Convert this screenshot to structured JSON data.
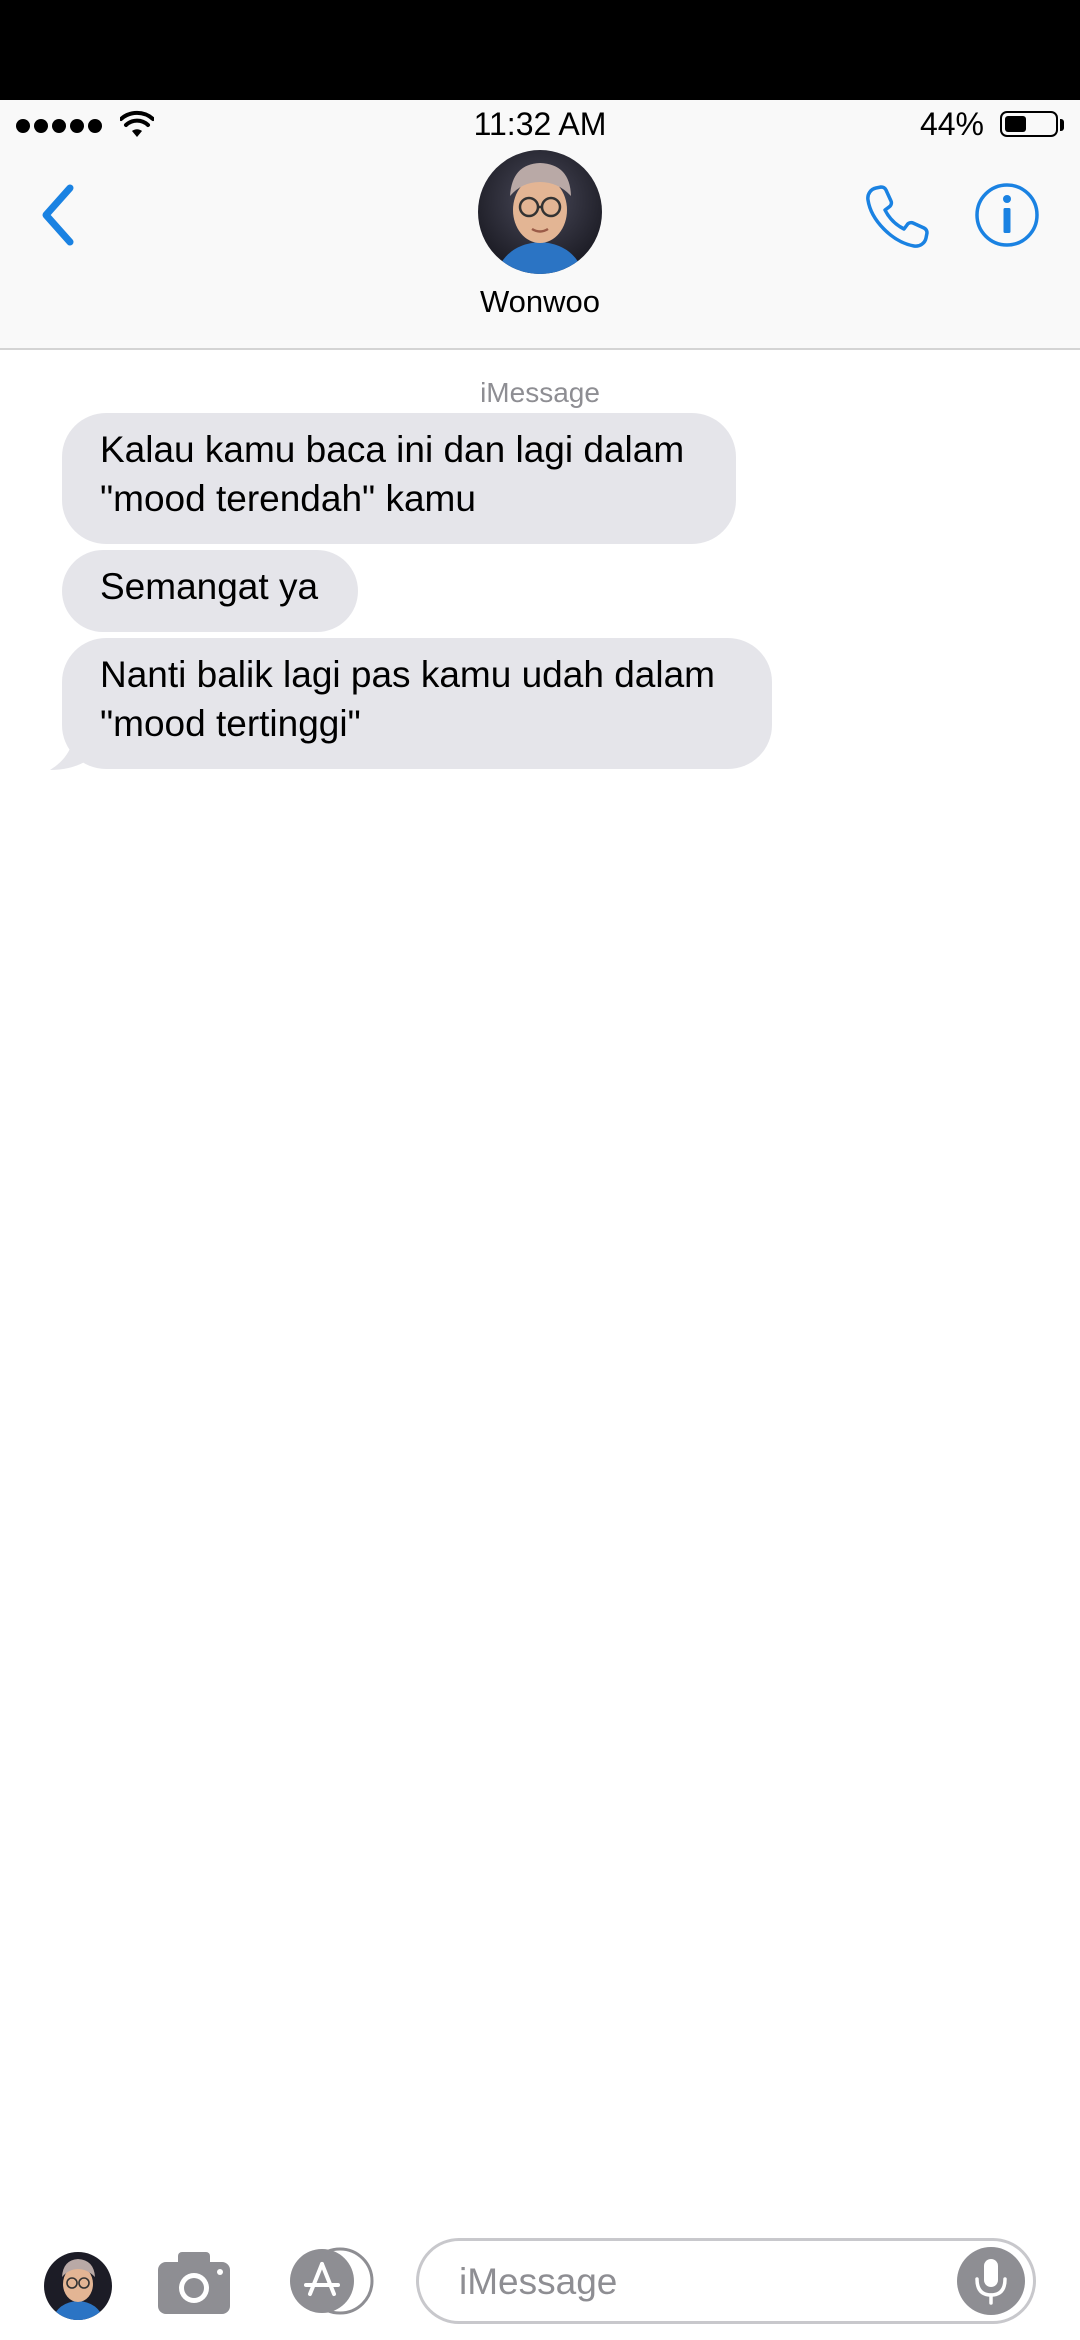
{
  "status_bar": {
    "time": "11:32 AM",
    "battery_percent": "44%",
    "battery_level": 0.44,
    "signal_bars": 5
  },
  "header": {
    "contact_name": "Wonwoo",
    "accent_color": "#1a82e2"
  },
  "conversation": {
    "service_label": "iMessage",
    "messages": [
      {
        "text": "Kalau kamu baca ini dan lagi dalam \"mood terendah\" kamu",
        "direction": "incoming"
      },
      {
        "text": "Semangat ya",
        "direction": "incoming"
      },
      {
        "text": "Nanti balik lagi pas kamu udah dalam \"mood tertinggi\"",
        "direction": "incoming"
      }
    ],
    "incoming_bubble_color": "#e5e5ea"
  },
  "compose": {
    "placeholder": "iMessage",
    "value": ""
  },
  "icons": {
    "back": "chevron-left-icon",
    "call": "phone-icon",
    "info": "info-icon",
    "camera": "camera-icon",
    "apps": "app-store-icon",
    "mic": "microphone-icon"
  }
}
